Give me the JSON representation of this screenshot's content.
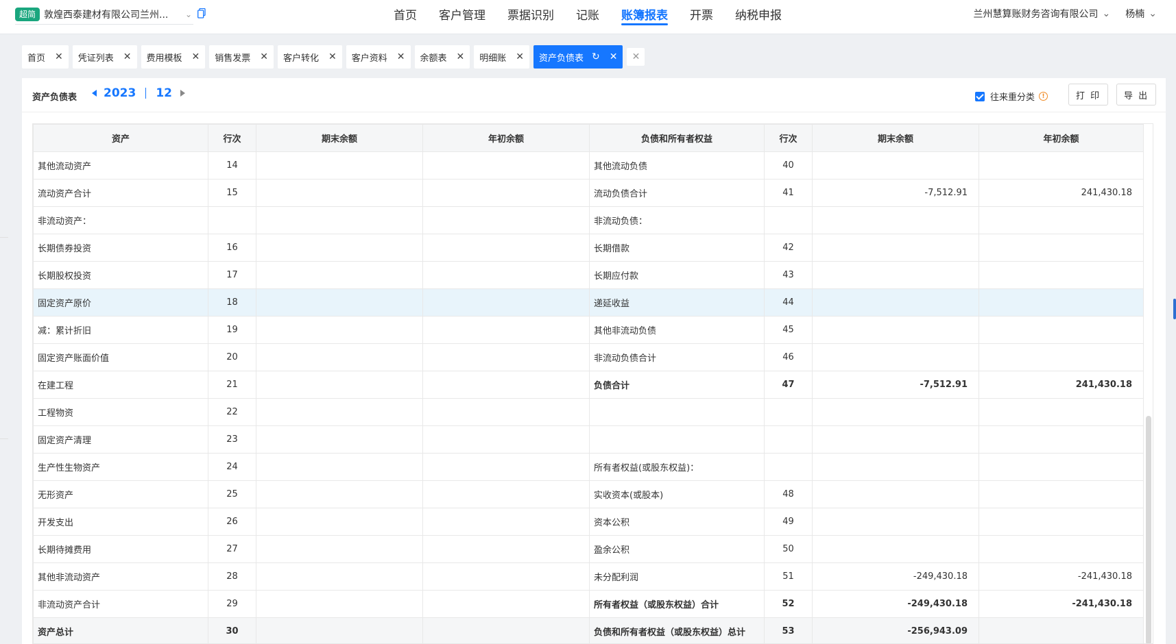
{
  "topnav": {
    "badge": "超简",
    "company": "敦煌西泰建材有限公司兰州...",
    "items": [
      {
        "label": "首页",
        "active": false
      },
      {
        "label": "客户管理",
        "active": false
      },
      {
        "label": "票据识别",
        "active": false
      },
      {
        "label": "记账",
        "active": false
      },
      {
        "label": "账簿报表",
        "active": true
      },
      {
        "label": "开票",
        "active": false
      },
      {
        "label": "纳税申报",
        "active": false
      }
    ],
    "org": "兰州慧算账财务咨询有限公司",
    "user": "杨楠"
  },
  "tabs": [
    {
      "label": "首页"
    },
    {
      "label": "凭证列表"
    },
    {
      "label": "费用模板"
    },
    {
      "label": "销售发票"
    },
    {
      "label": "客户转化"
    },
    {
      "label": "客户资料"
    },
    {
      "label": "余额表"
    },
    {
      "label": "明细账"
    },
    {
      "label": "资产负债表",
      "active": true
    }
  ],
  "toolbar": {
    "title": "资产负债表",
    "year": "2023",
    "month": "12",
    "reclass_label": "往来重分类",
    "print_label": "打 印",
    "export_label": "导 出"
  },
  "table": {
    "headers": [
      "资产",
      "行次",
      "期末余额",
      "年初余额",
      "负债和所有者权益",
      "行次",
      "期末余额",
      "年初余额"
    ],
    "rows": [
      [
        "其他流动资产",
        "14",
        "",
        "",
        "其他流动负债",
        "40",
        "",
        ""
      ],
      [
        "流动资产合计",
        "15",
        "",
        "",
        "流动负债合计",
        "41",
        "-7,512.91",
        "241,430.18"
      ],
      [
        "非流动资产：",
        "",
        "",
        "",
        "非流动负债：",
        "",
        "",
        ""
      ],
      [
        "长期债券投资",
        "16",
        "",
        "",
        "长期借款",
        "42",
        "",
        ""
      ],
      [
        "长期股权投资",
        "17",
        "",
        "",
        "长期应付款",
        "43",
        "",
        ""
      ],
      [
        "固定资产原价",
        "18",
        "",
        "",
        "递延收益",
        "44",
        "",
        ""
      ],
      [
        "减：累计折旧",
        "19",
        "",
        "",
        "其他非流动负债",
        "45",
        "",
        ""
      ],
      [
        "固定资产账面价值",
        "20",
        "",
        "",
        "非流动负债合计",
        "46",
        "",
        ""
      ],
      [
        "在建工程",
        "21",
        "",
        "",
        "负债合计",
        "47",
        "-7,512.91",
        "241,430.18"
      ],
      [
        "工程物资",
        "22",
        "",
        "",
        "",
        "",
        "",
        ""
      ],
      [
        "固定资产清理",
        "23",
        "",
        "",
        "",
        "",
        "",
        ""
      ],
      [
        "生产性生物资产",
        "24",
        "",
        "",
        "所有者权益(或股东权益)：",
        "",
        "",
        ""
      ],
      [
        "无形资产",
        "25",
        "",
        "",
        "实收资本(或股本)",
        "48",
        "",
        ""
      ],
      [
        "开发支出",
        "26",
        "",
        "",
        "资本公积",
        "49",
        "",
        ""
      ],
      [
        "长期待摊费用",
        "27",
        "",
        "",
        "盈余公积",
        "50",
        "",
        ""
      ],
      [
        "其他非流动资产",
        "28",
        "",
        "",
        "未分配利润",
        "51",
        "-249,430.18",
        "-241,430.18"
      ],
      [
        "非流动资产合计",
        "29",
        "",
        "",
        "所有者权益（或股东权益）合计",
        "52",
        "-249,430.18",
        "-241,430.18"
      ],
      [
        "资产总计",
        "30",
        "",
        "",
        "负债和所有者权益（或股东权益）总计",
        "53",
        "-256,943.09",
        ""
      ]
    ]
  }
}
